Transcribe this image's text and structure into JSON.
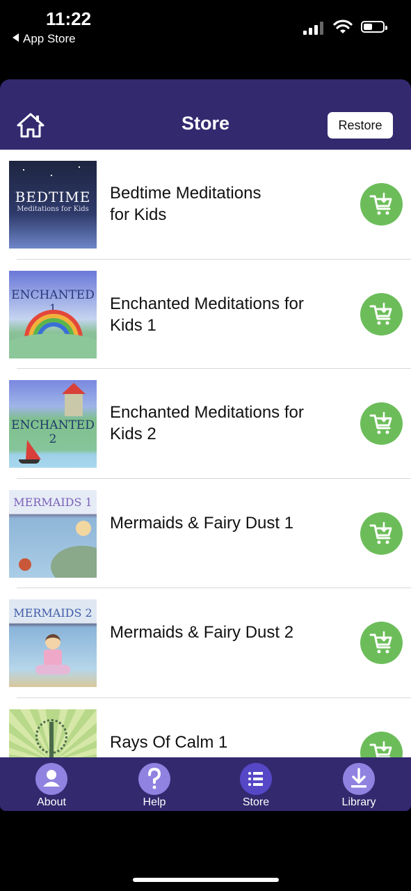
{
  "status_bar": {
    "time": "11:22",
    "back_label": "App Store"
  },
  "nav": {
    "title": "Store",
    "restore_label": "Restore"
  },
  "products": [
    {
      "title_line1": "Bedtime Meditations",
      "title_line2": "for Kids",
      "cover_title": "BEDTIME",
      "cover_subtitle": "Meditations for Kids"
    },
    {
      "title_line1": "Enchanted Meditations for",
      "title_line2": "Kids 1",
      "cover_title": "ENCHANTED 1"
    },
    {
      "title_line1": "Enchanted Meditations for",
      "title_line2": "Kids 2",
      "cover_title": "ENCHANTED 2"
    },
    {
      "title_line1": "Mermaids & Fairy Dust 1",
      "title_line2": "",
      "cover_title": "MERMAIDS 1"
    },
    {
      "title_line1": "Mermaids & Fairy Dust 2",
      "title_line2": "",
      "cover_title": "MERMAIDS 2"
    },
    {
      "title_line1": "Rays Of Calm 1",
      "title_line2": ""
    }
  ],
  "tabs": [
    {
      "label": "About",
      "icon": "person-icon"
    },
    {
      "label": "Help",
      "icon": "question-icon"
    },
    {
      "label": "Store",
      "icon": "list-icon"
    },
    {
      "label": "Library",
      "icon": "download-icon"
    }
  ],
  "colors": {
    "nav": "#32296f",
    "cart": "#6cbd5a",
    "tab_icon": "#8f82e0",
    "tab_icon_active": "#5647c7"
  }
}
